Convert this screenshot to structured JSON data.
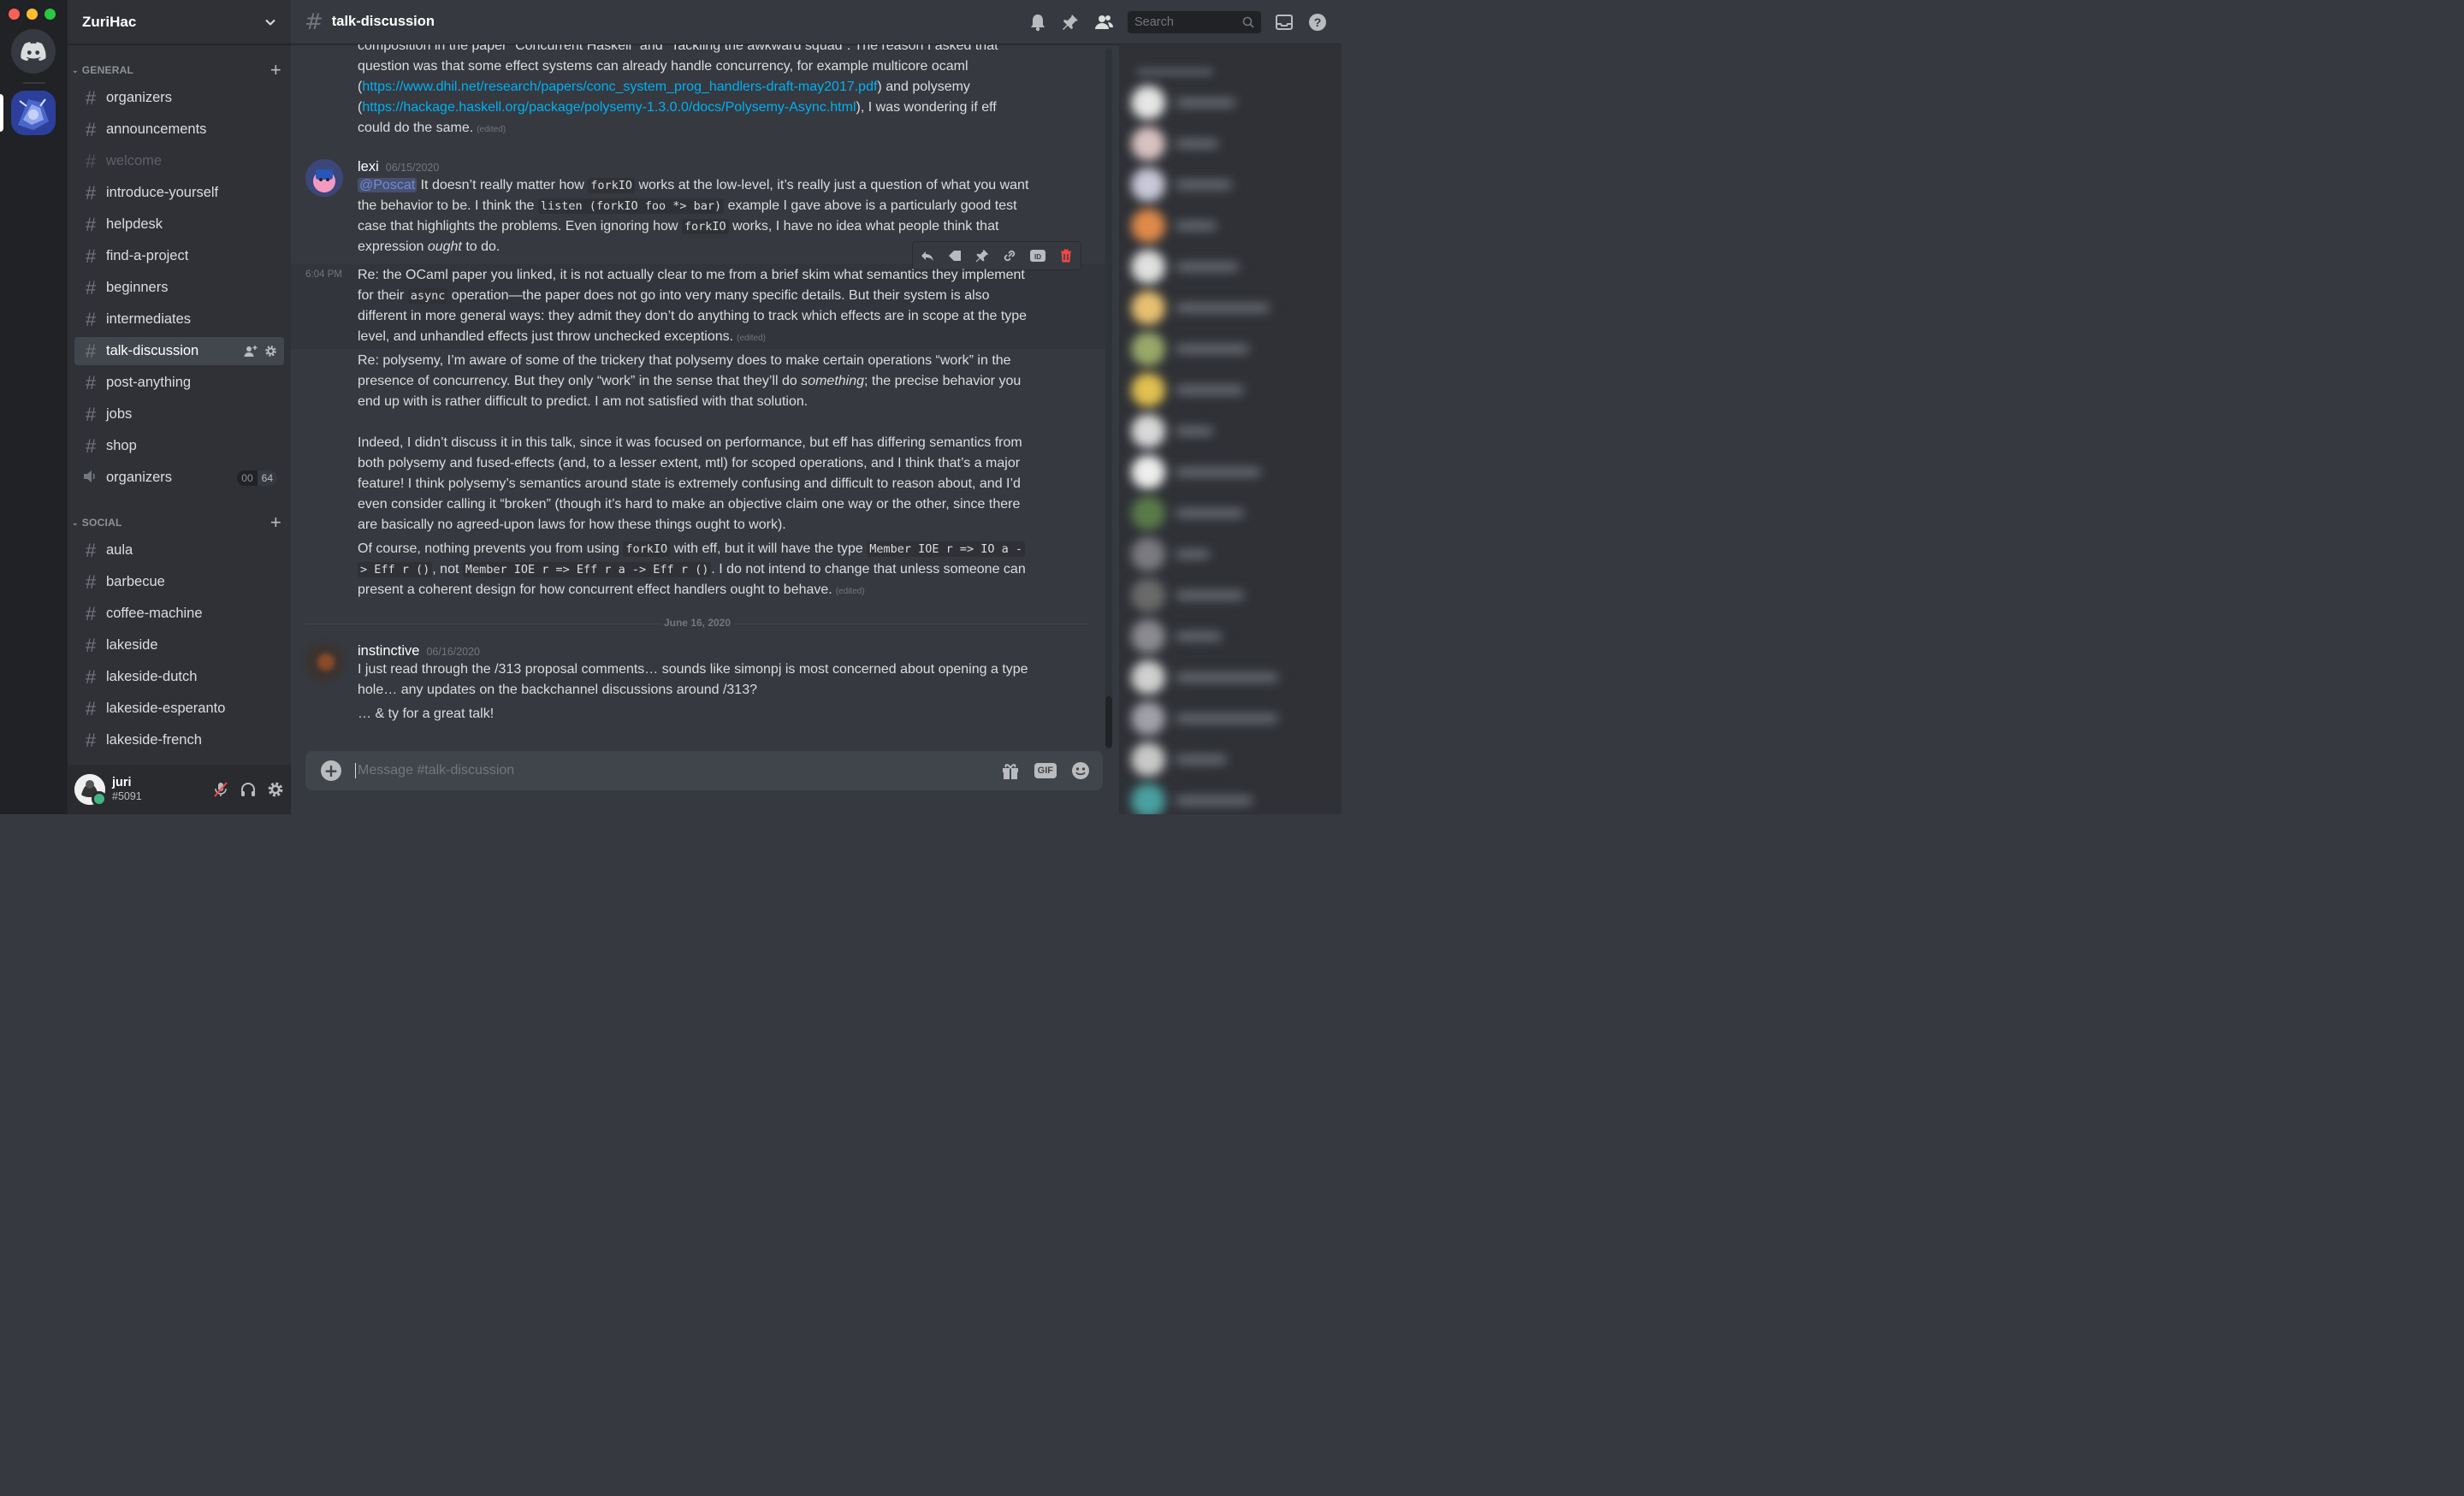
{
  "server": {
    "name": "ZuriHac"
  },
  "categories": [
    {
      "label": "GENERAL",
      "channels": [
        {
          "name": "organizers",
          "type": "text",
          "state": "normal"
        },
        {
          "name": "announcements",
          "type": "text",
          "state": "normal"
        },
        {
          "name": "welcome",
          "type": "text",
          "state": "muted"
        },
        {
          "name": "introduce-yourself",
          "type": "text",
          "state": "normal"
        },
        {
          "name": "helpdesk",
          "type": "text",
          "state": "normal"
        },
        {
          "name": "find-a-project",
          "type": "text",
          "state": "normal"
        },
        {
          "name": "beginners",
          "type": "text",
          "state": "normal"
        },
        {
          "name": "intermediates",
          "type": "text",
          "state": "normal"
        },
        {
          "name": "talk-discussion",
          "type": "text",
          "state": "active"
        },
        {
          "name": "post-anything",
          "type": "text",
          "state": "normal"
        },
        {
          "name": "jobs",
          "type": "text",
          "state": "normal"
        },
        {
          "name": "shop",
          "type": "text",
          "state": "normal"
        },
        {
          "name": "organizers",
          "type": "voice",
          "state": "normal",
          "badge": [
            "00",
            "64"
          ]
        }
      ]
    },
    {
      "label": "SOCIAL",
      "channels": [
        {
          "name": "aula",
          "type": "text",
          "state": "normal"
        },
        {
          "name": "barbecue",
          "type": "text",
          "state": "normal"
        },
        {
          "name": "coffee-machine",
          "type": "text",
          "state": "normal"
        },
        {
          "name": "lakeside",
          "type": "text",
          "state": "normal"
        },
        {
          "name": "lakeside-dutch",
          "type": "text",
          "state": "normal"
        },
        {
          "name": "lakeside-esperanto",
          "type": "text",
          "state": "normal"
        },
        {
          "name": "lakeside-french",
          "type": "text",
          "state": "normal"
        }
      ]
    }
  ],
  "user": {
    "name": "juri",
    "discriminator": "#5091",
    "status_color": "#43b581"
  },
  "channel_header": {
    "title": "talk-discussion",
    "search_placeholder": "Search"
  },
  "messages": {
    "top_continuation": {
      "line1": "composition in the paper “Concurrent Haskell” and “Tackling the awkward squad”. The reason I asked that",
      "line2": "question was that some effect systems can already handle concurrency, for example multicore ocaml",
      "line3_pre": "(",
      "link1": "https://www.dhil.net/research/papers/conc_system_prog_handlers-draft-may2017.pdf",
      "line3_post": ") and polysemy",
      "line4_pre": "(",
      "link2": "https://hackage.haskell.org/package/polysemy-1.3.0.0/docs/Polysemy-Async.html",
      "line4_post": "), I was wondering if eff",
      "line5": "could do the same.",
      "edited": "(edited)"
    },
    "lexi": {
      "author": "lexi",
      "timestamp": "06/15/2020",
      "mention": "@Poscat",
      "p1_a": " It doesn’t really matter how ",
      "code_forkIO": "forkIO",
      "p1_b": " works at the low-level, it’s really just a question of what you want",
      "p1_c": "the behavior to be. I think the ",
      "code_listen": "listen (forkIO foo *> bar)",
      "p1_d": " example I gave above is a particularly good test",
      "p1_e": "case that highlights the problems. Even ignoring how ",
      "p1_f": " works, I have no idea what people think that",
      "p1_g": "expression ",
      "p1_ought": "ought",
      "p1_h": " to do.",
      "side_time": "6:04 PM",
      "p2_a": "Re: the OCaml paper you linked, it is not actually clear to me from a brief skim what semantics they implement",
      "p2_b": "for their ",
      "code_async": "async",
      "p2_c": " operation—the paper does not go into very many specific details. But their system is also",
      "p2_d": "different in more general ways: they admit they don’t do anything to track which effects are in scope at the type",
      "p2_e": "level, and unhandled effects just throw unchecked exceptions.",
      "edited": "(edited)",
      "p3_a": "Re: polysemy, I’m aware of some of the trickery that polysemy does to make certain operations “work” in the",
      "p3_b": "presence of concurrency. But they only “work” in the sense that they’ll do ",
      "p3_something": "something",
      "p3_c": "; the precise behavior you",
      "p3_d": "end up with is rather difficult to predict. I am not satisfied with that solution.",
      "p4_a": "Indeed, I didn’t discuss it in this talk, since it was focused on performance, but eff has differing semantics from",
      "p4_b": "both polysemy and fused-effects (and, to a lesser extent, mtl) for scoped operations, and I think that’s a major",
      "p4_c": "feature! I think polysemy’s semantics around state is extremely confusing and difficult to reason about, and I’d",
      "p4_d": "even consider calling it “broken” (though it’s hard to make an objective claim one way or the other, since there",
      "p4_e": "are basically no agreed-upon laws for how these things ought to work).",
      "p5_a": "Of course, nothing prevents you from using ",
      "p5_b": " with eff, but it will have the type ",
      "code_type1a": "Member IOE r => IO a -",
      "code_type1b": "> Eff r ()",
      "p5_c": ", not ",
      "code_type2": "Member IOE r => Eff r a -> Eff r ()",
      "p5_d": ". I do not intend to change that unless someone can",
      "p5_e": "present a coherent design for how concurrent effect handlers ought to behave.",
      "edited2": "(edited)"
    },
    "date_divider": "June 16, 2020",
    "instinctive": {
      "author": "instinctive",
      "timestamp": "06/16/2020",
      "line1": "I just read through the /313 proposal comments… sounds like simonpj is most concerned about opening a type",
      "line2": "hole… any updates on the backchannel discussions around /313?",
      "line3": "… & ty for a great talk!"
    }
  },
  "composer": {
    "placeholder": "Message #talk-discussion",
    "gif_label": "GIF"
  },
  "colors": {
    "accent": "#7289da",
    "link": "#00b0f4",
    "danger": "#f04747",
    "online": "#43b581"
  }
}
